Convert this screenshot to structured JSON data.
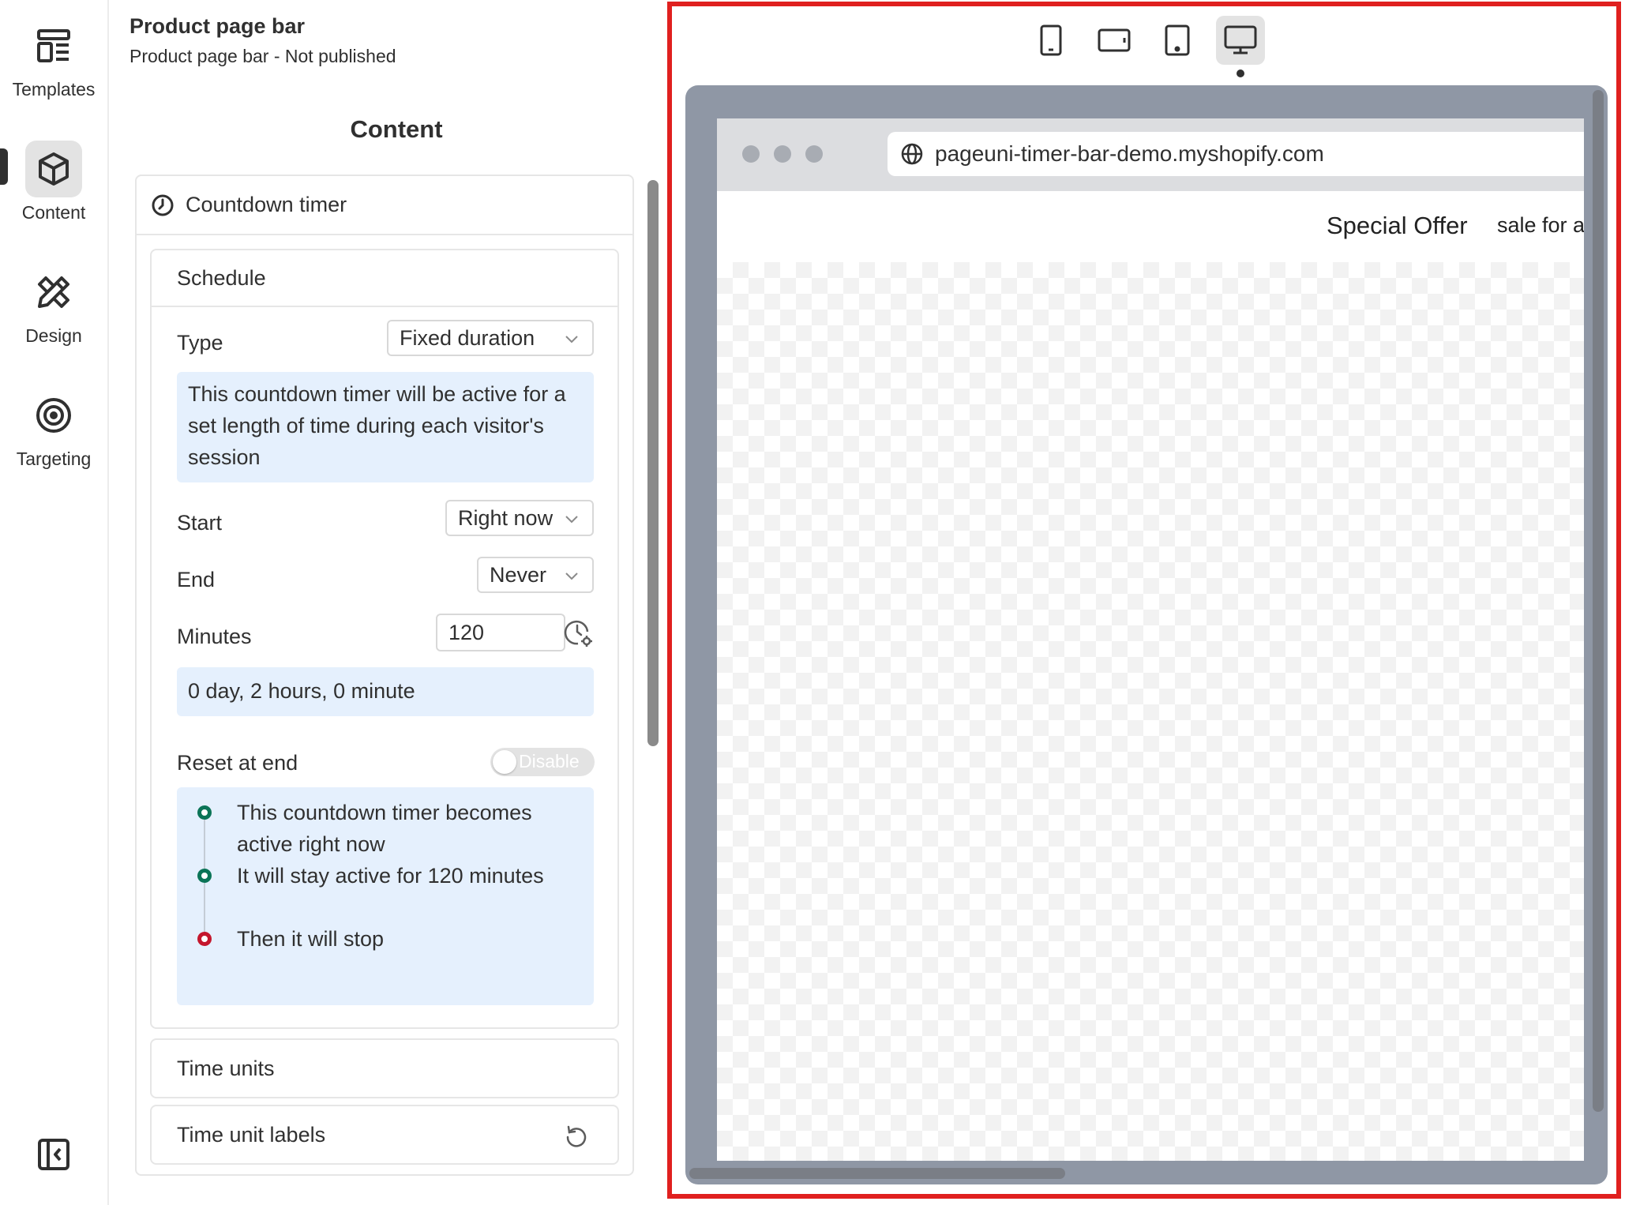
{
  "nav": {
    "items": [
      {
        "label": "Templates",
        "icon": "templates-icon"
      },
      {
        "label": "Content",
        "icon": "cube-icon",
        "active": true
      },
      {
        "label": "Design",
        "icon": "design-tools-icon"
      },
      {
        "label": "Targeting",
        "icon": "target-icon"
      }
    ],
    "collapse_icon": "collapse-sidebar-icon"
  },
  "header": {
    "title": "Product page bar",
    "subtitle": "Product page bar - Not published"
  },
  "section_title": "Content",
  "countdown": {
    "title": "Countdown timer",
    "schedule": {
      "title": "Schedule",
      "type_label": "Type",
      "type_value": "Fixed duration",
      "type_info": "This countdown timer will be active for a set length of time during each visitor's session",
      "start_label": "Start",
      "start_value": "Right now",
      "end_label": "End",
      "end_value": "Never",
      "minutes_label": "Minutes",
      "minutes_value": "120",
      "duration_text": "0 day, 2 hours, 0 minute",
      "reset_label": "Reset at end",
      "reset_toggle": "Disable",
      "timeline": [
        {
          "text": "This countdown timer becomes active right now",
          "status": "green"
        },
        {
          "text": "It will stay active for 120 minutes",
          "status": "green"
        },
        {
          "text": "Then it will stop",
          "status": "red"
        }
      ]
    },
    "time_units_label": "Time units",
    "time_unit_labels_label": "Time unit labels"
  },
  "preview": {
    "devices": [
      "mobile-portrait",
      "mobile-landscape",
      "tablet",
      "desktop"
    ],
    "active_device": "desktop",
    "url": "pageuni-timer-bar-demo.myshopify.com",
    "bar_title": "Special Offer",
    "bar_text": "sale for a"
  },
  "colors": {
    "accent_green": "#0b7457",
    "accent_red": "#c4162d",
    "info_bg": "#e5f0fd",
    "highlight_border": "#e0201f"
  }
}
